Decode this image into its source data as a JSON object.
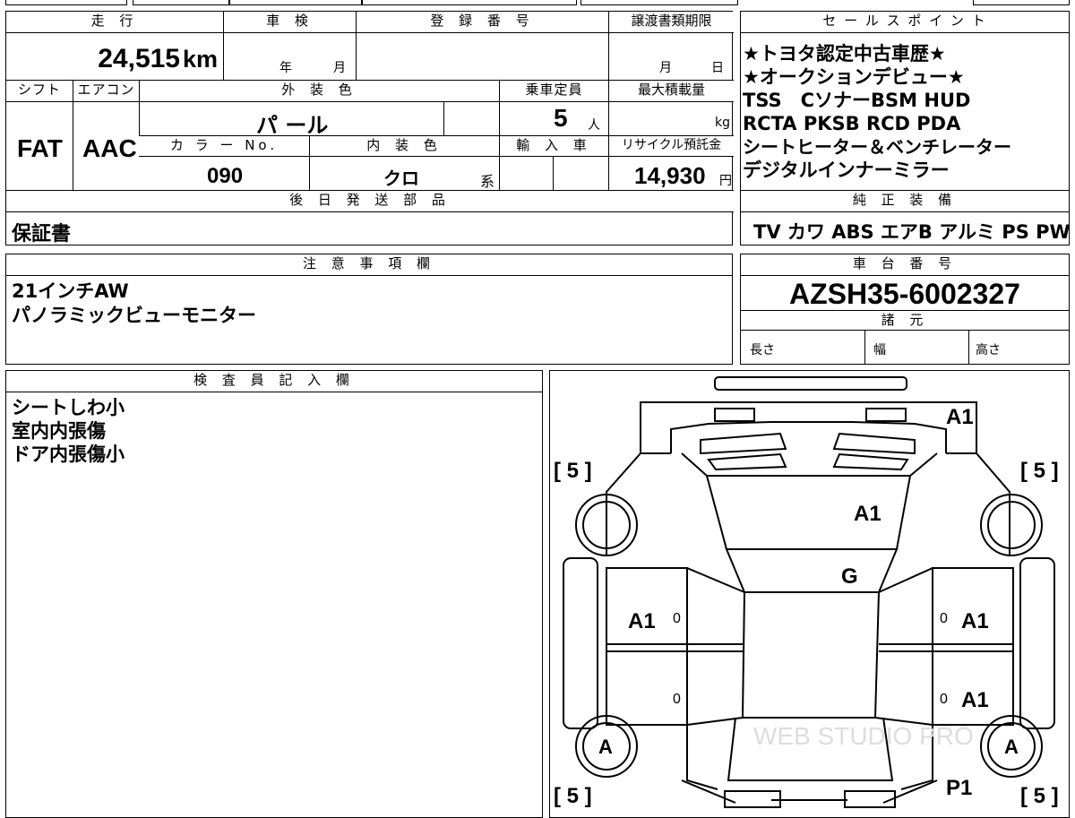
{
  "top_partial": "",
  "spec": {
    "headers": {
      "mileage": "走 行",
      "inspection": "車 検",
      "registration": "登 録 番 号",
      "transfer_docs": "譲渡書類期限",
      "shift": "シフト",
      "aircon": "エアコン",
      "exterior_color": "外 装 色",
      "capacity": "乗車定員",
      "max_load": "最大積載量",
      "color_no": "カ ラ ー No.",
      "interior_color": "内 装 色",
      "import": "輸 入 車",
      "recycle": "リサイクル預託金",
      "later_parts": "後 日 発 送 部 品"
    },
    "mileage_value": "24,515",
    "mileage_unit": "km",
    "inspection_year": "年",
    "inspection_month": "月",
    "transfer_month": "月",
    "transfer_day": "日",
    "shift_value": "FAT",
    "aircon_value": "AAC",
    "exterior_value": "パ ール",
    "capacity_value": "5",
    "capacity_unit": "人",
    "max_load_unit": "kg",
    "color_no_value": "090",
    "interior_value": "クロ",
    "interior_suffix": "系",
    "recycle_value": "14,930",
    "recycle_unit": "円",
    "later_parts_value": "保証書"
  },
  "sales_points": {
    "header": "セ ー ル ス ポ イ ン ト",
    "lines": [
      "★トヨタ認定中古車歴★",
      "★オークションデビュー★",
      "TSS　CソナーBSM HUD",
      "RCTA PKSB RCD PDA",
      "シートヒーター＆ベンチレーター",
      "デジタルインナーミラー"
    ]
  },
  "equipment": {
    "header": "純 正 装 備",
    "value": "TV カワ ABS エアB アルミ PS PW"
  },
  "notes": {
    "header": "注 意 事 項 欄",
    "lines": [
      "21インチAW",
      "パノラミックビューモニター"
    ]
  },
  "chassis": {
    "header": "車 台 番 号",
    "value": "AZSH35-6002327",
    "specs_header": "諸 元",
    "length": "長さ",
    "width": "幅",
    "height": "高さ"
  },
  "inspector": {
    "header": "検 査 員 記 入 欄",
    "lines": [
      "シートしわ小",
      "室内内張傷",
      "ドア内張傷小"
    ]
  },
  "diagram": {
    "marks": {
      "rear_top": "A1",
      "roof": "A1",
      "windshield": "G",
      "left_front_door": "A1",
      "right_front_door": "A1",
      "right_rear_door": "A1",
      "left_front_wheel": "A",
      "right_front_wheel": "A",
      "front_bumper": "P1",
      "tire_tl": "[ 5 ]",
      "tire_tr": "[ 5 ]",
      "tire_bl": "[ 5 ]",
      "tire_br": "[ 5 ]",
      "zero": "0"
    },
    "watermark": "WEB STUDIO PRO"
  }
}
